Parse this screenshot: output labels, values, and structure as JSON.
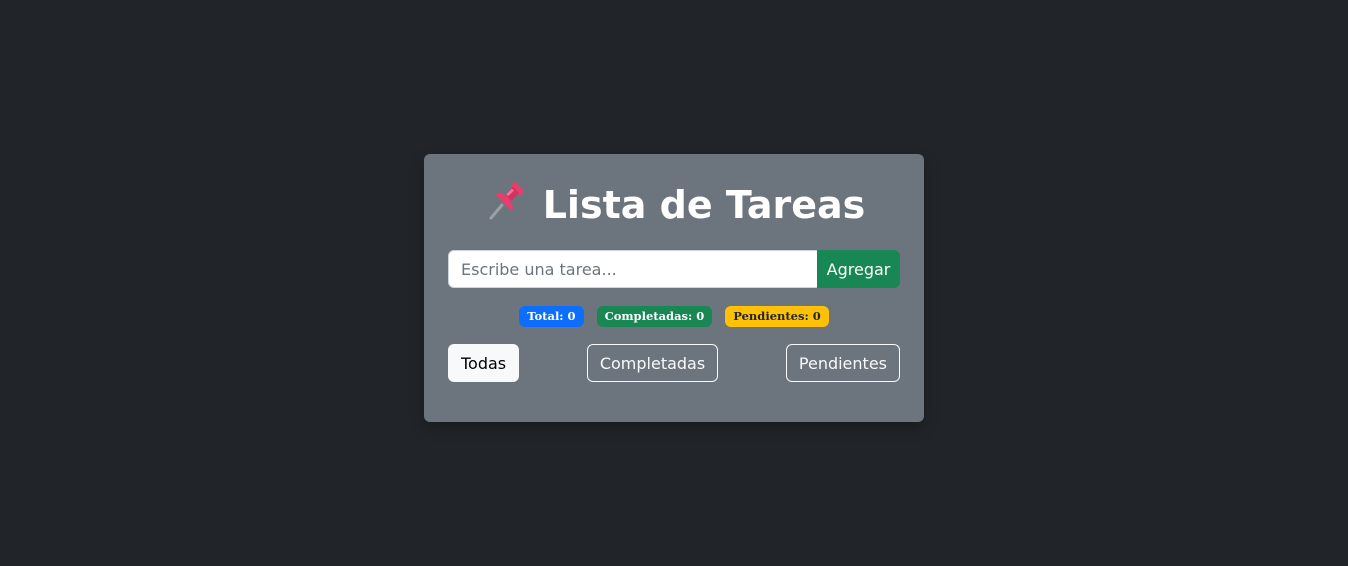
{
  "card": {
    "title": "Lista de Tareas",
    "title_icon": "pushpin-icon"
  },
  "input": {
    "placeholder": "Escribe una tarea...",
    "value": ""
  },
  "add_button": {
    "label": "Agregar"
  },
  "badges": {
    "total": "Total: 0",
    "completed": "Completadas: 0",
    "pending": "Pendientes: 0"
  },
  "filters": {
    "all": "Todas",
    "completed": "Completadas",
    "pending": "Pendientes",
    "active": "all"
  },
  "colors": {
    "background": "#212529",
    "card": "#6c757d",
    "primary": "#0d6efd",
    "success": "#198754",
    "warning": "#ffc107",
    "light": "#f8f9fa"
  }
}
